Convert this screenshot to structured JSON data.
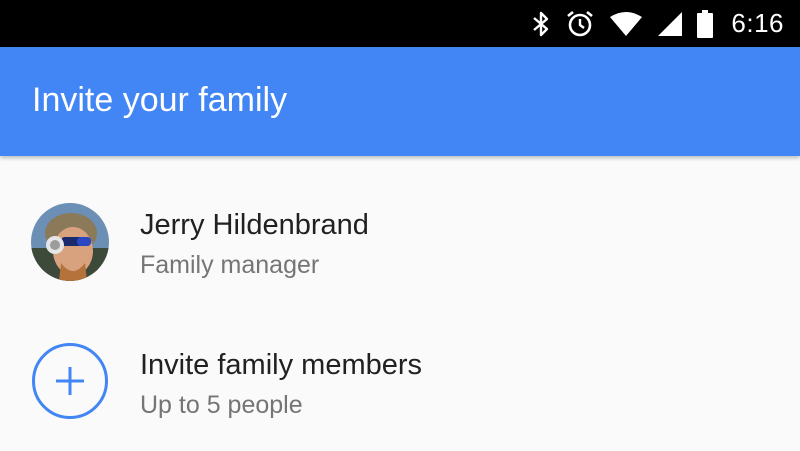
{
  "status_bar": {
    "time": "6:16",
    "icons": [
      "bluetooth-icon",
      "alarm-icon",
      "wifi-icon",
      "signal-icon",
      "battery-icon"
    ]
  },
  "app_bar": {
    "title": "Invite your family",
    "color": "#4285f4"
  },
  "list": {
    "items": [
      {
        "primary": "Jerry Hildenbrand",
        "secondary": "Family manager",
        "icon": "avatar"
      },
      {
        "primary": "Invite family members",
        "secondary": "Up to 5 people",
        "icon": "add-circle-icon"
      }
    ]
  },
  "colors": {
    "accent": "#4285f4",
    "background": "#fafafa",
    "primary_text": "#212121",
    "secondary_text": "#757575"
  }
}
